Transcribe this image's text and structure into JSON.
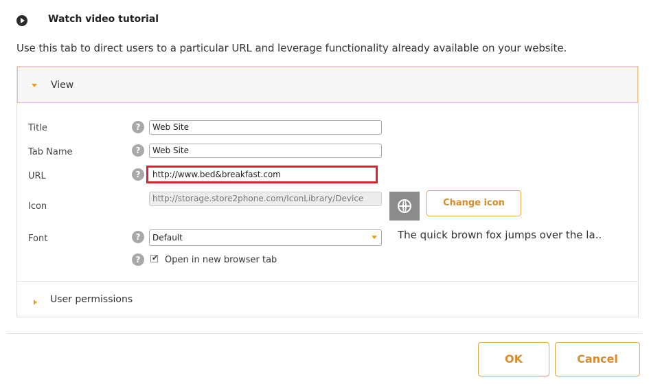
{
  "header": {
    "tutorial_label": "Watch video tutorial",
    "intro_text": "Use this tab to direct users to a particular URL and leverage functionality already available on your website."
  },
  "view_section": {
    "label": "View",
    "fields": {
      "title": {
        "label": "Title",
        "value": "Web Site"
      },
      "tab_name": {
        "label": "Tab Name",
        "value": "Web Site"
      },
      "url": {
        "label": "URL",
        "value": "http://www.bed&breakfast.com"
      },
      "icon": {
        "label": "Icon",
        "value": "http://storage.store2phone.com/IconLibrary/Device"
      },
      "font": {
        "label": "Font",
        "value": "Default"
      }
    },
    "change_icon_label": "Change icon",
    "font_preview": "The quick brown fox jumps over the la..",
    "open_new_tab_label": "Open in new browser tab",
    "open_new_tab_checked": true
  },
  "user_permissions_section": {
    "label": "User permissions"
  },
  "footer": {
    "ok_label": "OK",
    "cancel_label": "Cancel"
  },
  "colors": {
    "accent_orange": "#f39c12",
    "highlight_red": "#d9232e"
  }
}
